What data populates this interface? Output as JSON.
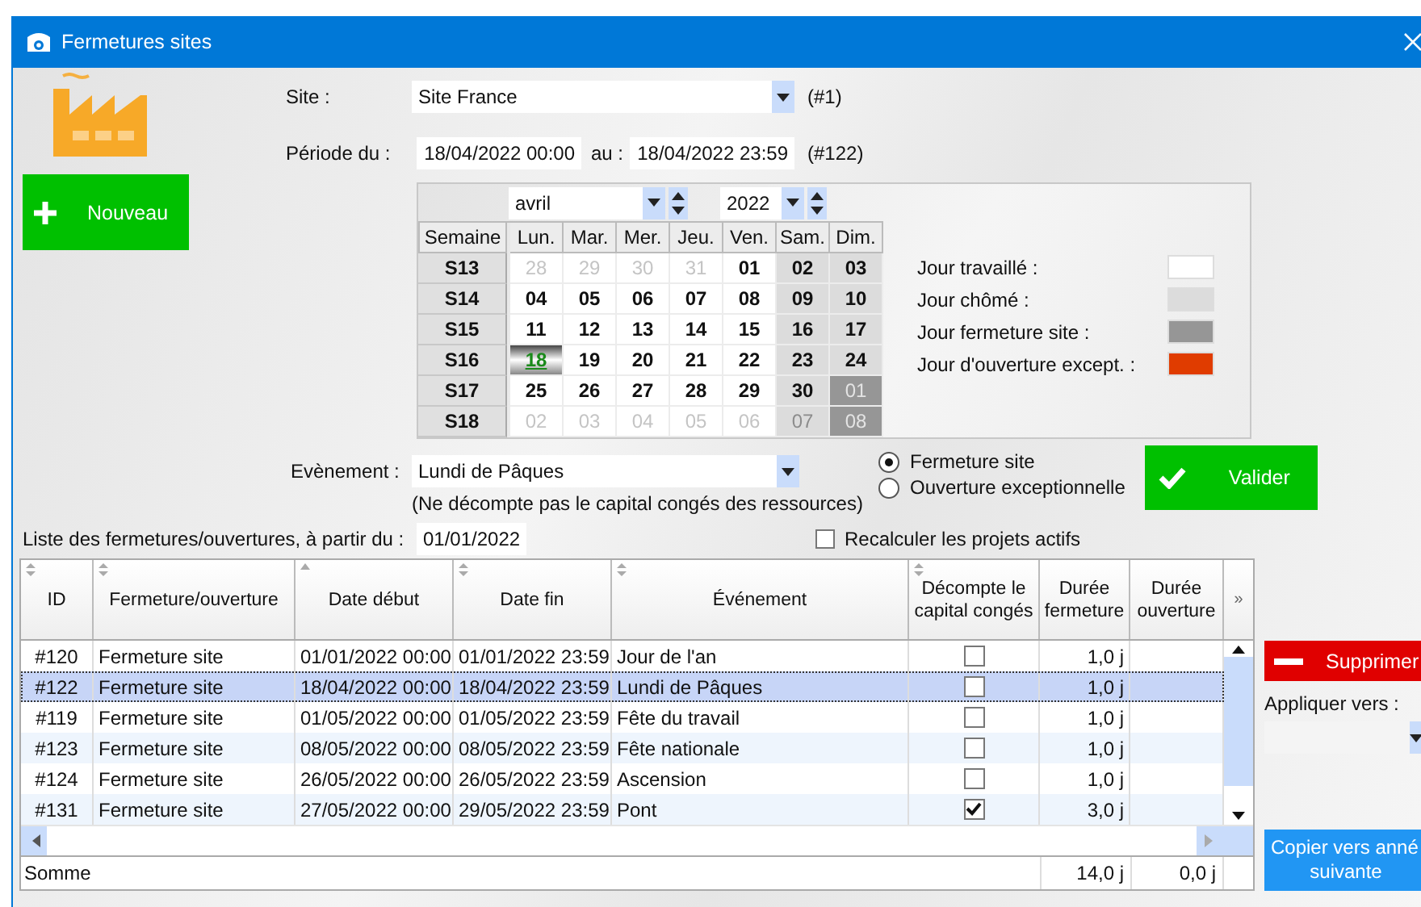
{
  "window": {
    "title": "Fermetures sites"
  },
  "new_button": "Nouveau",
  "site": {
    "label": "Site :",
    "value": "Site France",
    "ref": "(#1)"
  },
  "period": {
    "label": "Période du :",
    "from": "18/04/2022 00:00",
    "to_label": "au :",
    "to": "18/04/2022 23:59",
    "ref": "(#122)"
  },
  "calendar": {
    "month": "avril",
    "year": "2022",
    "week_header": "Semaine",
    "day_headers": [
      "Lun.",
      "Mar.",
      "Mer.",
      "Jeu.",
      "Ven.",
      "Sam.",
      "Dim."
    ],
    "weeks": [
      {
        "week": "S13",
        "days": [
          {
            "day": "28",
            "kind": "work",
            "outside": true,
            "selected": false
          },
          {
            "day": "29",
            "kind": "work",
            "outside": true,
            "selected": false
          },
          {
            "day": "30",
            "kind": "work",
            "outside": true,
            "selected": false
          },
          {
            "day": "31",
            "kind": "work",
            "outside": true,
            "selected": false
          },
          {
            "day": "01",
            "kind": "work",
            "outside": false,
            "selected": false
          },
          {
            "day": "02",
            "kind": "off",
            "outside": false,
            "selected": false
          },
          {
            "day": "03",
            "kind": "off",
            "outside": false,
            "selected": false
          }
        ]
      },
      {
        "week": "S14",
        "days": [
          {
            "day": "04",
            "kind": "work",
            "outside": false,
            "selected": false
          },
          {
            "day": "05",
            "kind": "work",
            "outside": false,
            "selected": false
          },
          {
            "day": "06",
            "kind": "work",
            "outside": false,
            "selected": false
          },
          {
            "day": "07",
            "kind": "work",
            "outside": false,
            "selected": false
          },
          {
            "day": "08",
            "kind": "work",
            "outside": false,
            "selected": false
          },
          {
            "day": "09",
            "kind": "off",
            "outside": false,
            "selected": false
          },
          {
            "day": "10",
            "kind": "off",
            "outside": false,
            "selected": false
          }
        ]
      },
      {
        "week": "S15",
        "days": [
          {
            "day": "11",
            "kind": "work",
            "outside": false,
            "selected": false
          },
          {
            "day": "12",
            "kind": "work",
            "outside": false,
            "selected": false
          },
          {
            "day": "13",
            "kind": "work",
            "outside": false,
            "selected": false
          },
          {
            "day": "14",
            "kind": "work",
            "outside": false,
            "selected": false
          },
          {
            "day": "15",
            "kind": "work",
            "outside": false,
            "selected": false
          },
          {
            "day": "16",
            "kind": "off",
            "outside": false,
            "selected": false
          },
          {
            "day": "17",
            "kind": "off",
            "outside": false,
            "selected": false
          }
        ]
      },
      {
        "week": "S16",
        "days": [
          {
            "day": "18",
            "kind": "work",
            "outside": false,
            "selected": true
          },
          {
            "day": "19",
            "kind": "work",
            "outside": false,
            "selected": false
          },
          {
            "day": "20",
            "kind": "work",
            "outside": false,
            "selected": false
          },
          {
            "day": "21",
            "kind": "work",
            "outside": false,
            "selected": false
          },
          {
            "day": "22",
            "kind": "work",
            "outside": false,
            "selected": false
          },
          {
            "day": "23",
            "kind": "off",
            "outside": false,
            "selected": false
          },
          {
            "day": "24",
            "kind": "off",
            "outside": false,
            "selected": false
          }
        ]
      },
      {
        "week": "S17",
        "days": [
          {
            "day": "25",
            "kind": "work",
            "outside": false,
            "selected": false
          },
          {
            "day": "26",
            "kind": "work",
            "outside": false,
            "selected": false
          },
          {
            "day": "27",
            "kind": "work",
            "outside": false,
            "selected": false
          },
          {
            "day": "28",
            "kind": "work",
            "outside": false,
            "selected": false
          },
          {
            "day": "29",
            "kind": "work",
            "outside": false,
            "selected": false
          },
          {
            "day": "30",
            "kind": "off",
            "outside": false,
            "selected": false
          },
          {
            "day": "01",
            "kind": "closed",
            "outside": true,
            "selected": false
          }
        ]
      },
      {
        "week": "S18",
        "days": [
          {
            "day": "02",
            "kind": "work",
            "outside": true,
            "selected": false
          },
          {
            "day": "03",
            "kind": "work",
            "outside": true,
            "selected": false
          },
          {
            "day": "04",
            "kind": "work",
            "outside": true,
            "selected": false
          },
          {
            "day": "05",
            "kind": "work",
            "outside": true,
            "selected": false
          },
          {
            "day": "06",
            "kind": "work",
            "outside": true,
            "selected": false
          },
          {
            "day": "07",
            "kind": "off",
            "outside": true,
            "selected": false
          },
          {
            "day": "08",
            "kind": "closed",
            "outside": true,
            "selected": false
          }
        ]
      }
    ]
  },
  "legend": [
    {
      "label": "Jour travaillé :",
      "color": "#ffffff"
    },
    {
      "label": "Jour chômé :",
      "color": "#dcdcdc"
    },
    {
      "label": "Jour fermeture site :",
      "color": "#969696"
    },
    {
      "label": "Jour d'ouverture except. :",
      "color": "#e03c00"
    }
  ],
  "event": {
    "label": "Evènement :",
    "value": "Lundi de Pâques",
    "note": "(Ne décompte pas le capital congés des ressources)",
    "options": [
      {
        "label": "Fermeture site",
        "selected": true
      },
      {
        "label": "Ouverture exceptionnelle",
        "selected": false
      }
    ]
  },
  "validate_button": "Valider",
  "list": {
    "label": "Liste des fermetures/ouvertures, à partir du :",
    "from": "01/01/2022"
  },
  "recalc": {
    "label": "Recalculer les projets actifs",
    "checked": false
  },
  "table": {
    "columns": [
      {
        "label": "ID",
        "sortable": true,
        "sorted": false
      },
      {
        "label": "Fermeture/ouverture",
        "sortable": true,
        "sorted": false
      },
      {
        "label": "Date début",
        "sorted": true
      },
      {
        "label": "Date fin",
        "sortable": true,
        "sorted": false
      },
      {
        "label": "Événement",
        "sortable": true,
        "sorted": false
      },
      {
        "label": "Décompte le capital congés",
        "sortable": true,
        "sorted": false
      },
      {
        "label": "Durée fermeture",
        "sortable": false,
        "sorted": false
      },
      {
        "label": "Durée ouverture",
        "sortable": false,
        "sorted": false
      }
    ],
    "more": "»",
    "rows": [
      {
        "id": "#120",
        "type": "Fermeture site",
        "start": "01/01/2022 00:00",
        "end": "01/01/2022 23:59",
        "event": "Jour de l'an",
        "counts": false,
        "closing": "1,0 j",
        "selected": false
      },
      {
        "id": "#122",
        "type": "Fermeture site",
        "start": "18/04/2022 00:00",
        "end": "18/04/2022 23:59",
        "event": "Lundi de Pâques",
        "counts": false,
        "closing": "1,0 j",
        "selected": true
      },
      {
        "id": "#119",
        "type": "Fermeture site",
        "start": "01/05/2022 00:00",
        "end": "01/05/2022 23:59",
        "event": "Fête du travail",
        "counts": false,
        "closing": "1,0 j",
        "selected": false
      },
      {
        "id": "#123",
        "type": "Fermeture site",
        "start": "08/05/2022 00:00",
        "end": "08/05/2022 23:59",
        "event": "Fête nationale",
        "counts": false,
        "closing": "1,0 j",
        "selected": false
      },
      {
        "id": "#124",
        "type": "Fermeture site",
        "start": "26/05/2022 00:00",
        "end": "26/05/2022 23:59",
        "event": "Ascension",
        "counts": false,
        "closing": "1,0 j",
        "selected": false
      },
      {
        "id": "#131",
        "type": "Fermeture site",
        "start": "27/05/2022 00:00",
        "end": "29/05/2022 23:59",
        "event": "Pont",
        "counts": true,
        "closing": "3,0 j",
        "selected": false
      }
    ],
    "totals": {
      "label": "Somme",
      "closing": "14,0 j",
      "opening": "0,0 j"
    }
  },
  "delete_button": "Supprimer",
  "apply": {
    "label": "Appliquer vers :"
  },
  "copy_button": [
    "Copier vers anné",
    "suivante"
  ]
}
